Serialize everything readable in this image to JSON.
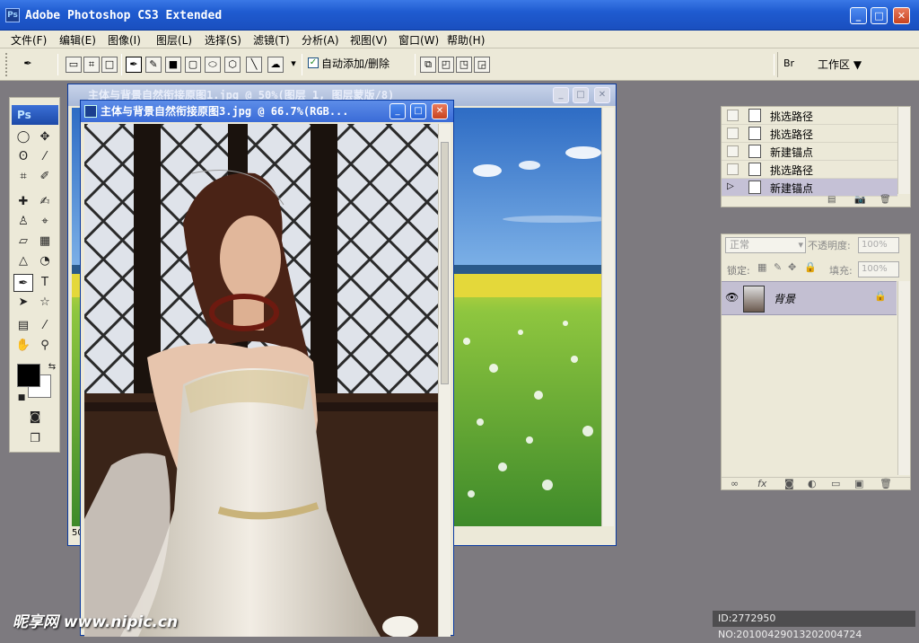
{
  "app": {
    "title": "Adobe Photoshop CS3 Extended",
    "icon_text": "Ps"
  },
  "window_controls": {
    "minimize": "_",
    "maximize": "□",
    "close": "✕"
  },
  "menu": [
    "文件(F)",
    "编辑(E)",
    "图像(I)",
    "图层(L)",
    "选择(S)",
    "滤镜(T)",
    "分析(A)",
    "视图(V)",
    "窗口(W)",
    "帮助(H)"
  ],
  "options_bar": {
    "auto_add_delete_label": "自动添加/删除",
    "auto_add_delete_checked": true,
    "workspace_label": "工作区 ▼"
  },
  "toolbox": {
    "logo": "Ps"
  },
  "documents": {
    "front": {
      "title": "主体与背景自然衔接原图3.jpg @ 66.7%(RGB..."
    },
    "back": {
      "title": "主体与背景自然衔接原图1.jpg @ 50%(图层 1, 图层蒙版/8)",
      "zoom": "50"
    }
  },
  "history": {
    "items": [
      {
        "label": "挑选路径",
        "selected": false
      },
      {
        "label": "挑选路径",
        "selected": false
      },
      {
        "label": "新建锚点",
        "selected": false
      },
      {
        "label": "挑选路径",
        "selected": false
      },
      {
        "label": "新建锚点",
        "selected": true
      }
    ]
  },
  "layers": {
    "blend_mode": "正常",
    "opacity_label": "不透明度:",
    "opacity_value": "100%",
    "lock_label": "锁定:",
    "fill_label": "填充:",
    "fill_value": "100%",
    "layer_name": "背景"
  },
  "overlay": {
    "watermark": "昵享网 www.nipic.cn",
    "id_text": "ID:2772950 NO:20100429013202004724"
  },
  "colors": {
    "accent": "#1f5bd0",
    "panel": "#ece9d8",
    "desktop": "#7d7a7f"
  }
}
